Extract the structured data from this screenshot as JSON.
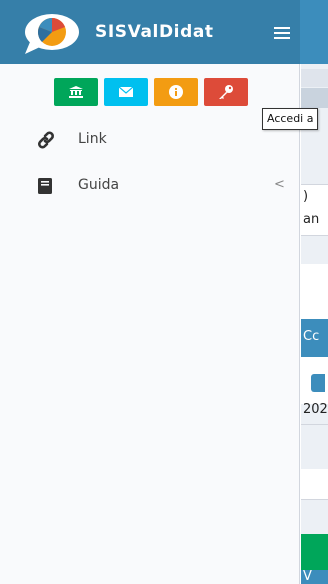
{
  "header": {
    "brand_name": "SISValDidat",
    "menu_icon": "hamburger-icon",
    "logo": "pie-chart-speech-bubble-logo"
  },
  "sidebar": {
    "quick_buttons": [
      {
        "icon": "institution-icon",
        "color": "#00a65a"
      },
      {
        "icon": "envelope-icon",
        "color": "#00c0ef"
      },
      {
        "icon": "info-circle-icon",
        "color": "#f39c12"
      },
      {
        "icon": "key-icon",
        "color": "#dd4b39"
      }
    ],
    "items": [
      {
        "label": "Link",
        "icon": "link-icon"
      },
      {
        "label": "Guida",
        "icon": "book-icon",
        "caret": "<"
      }
    ]
  },
  "tooltip": {
    "text": "Accedi a"
  },
  "background_peek": {
    "fragments": [
      ")",
      "an",
      "Cc",
      "202",
      "V"
    ]
  },
  "colors": {
    "header": "#3c8dbc",
    "brand": "#367fa9",
    "sidebar_bg": "#f9fafc"
  }
}
